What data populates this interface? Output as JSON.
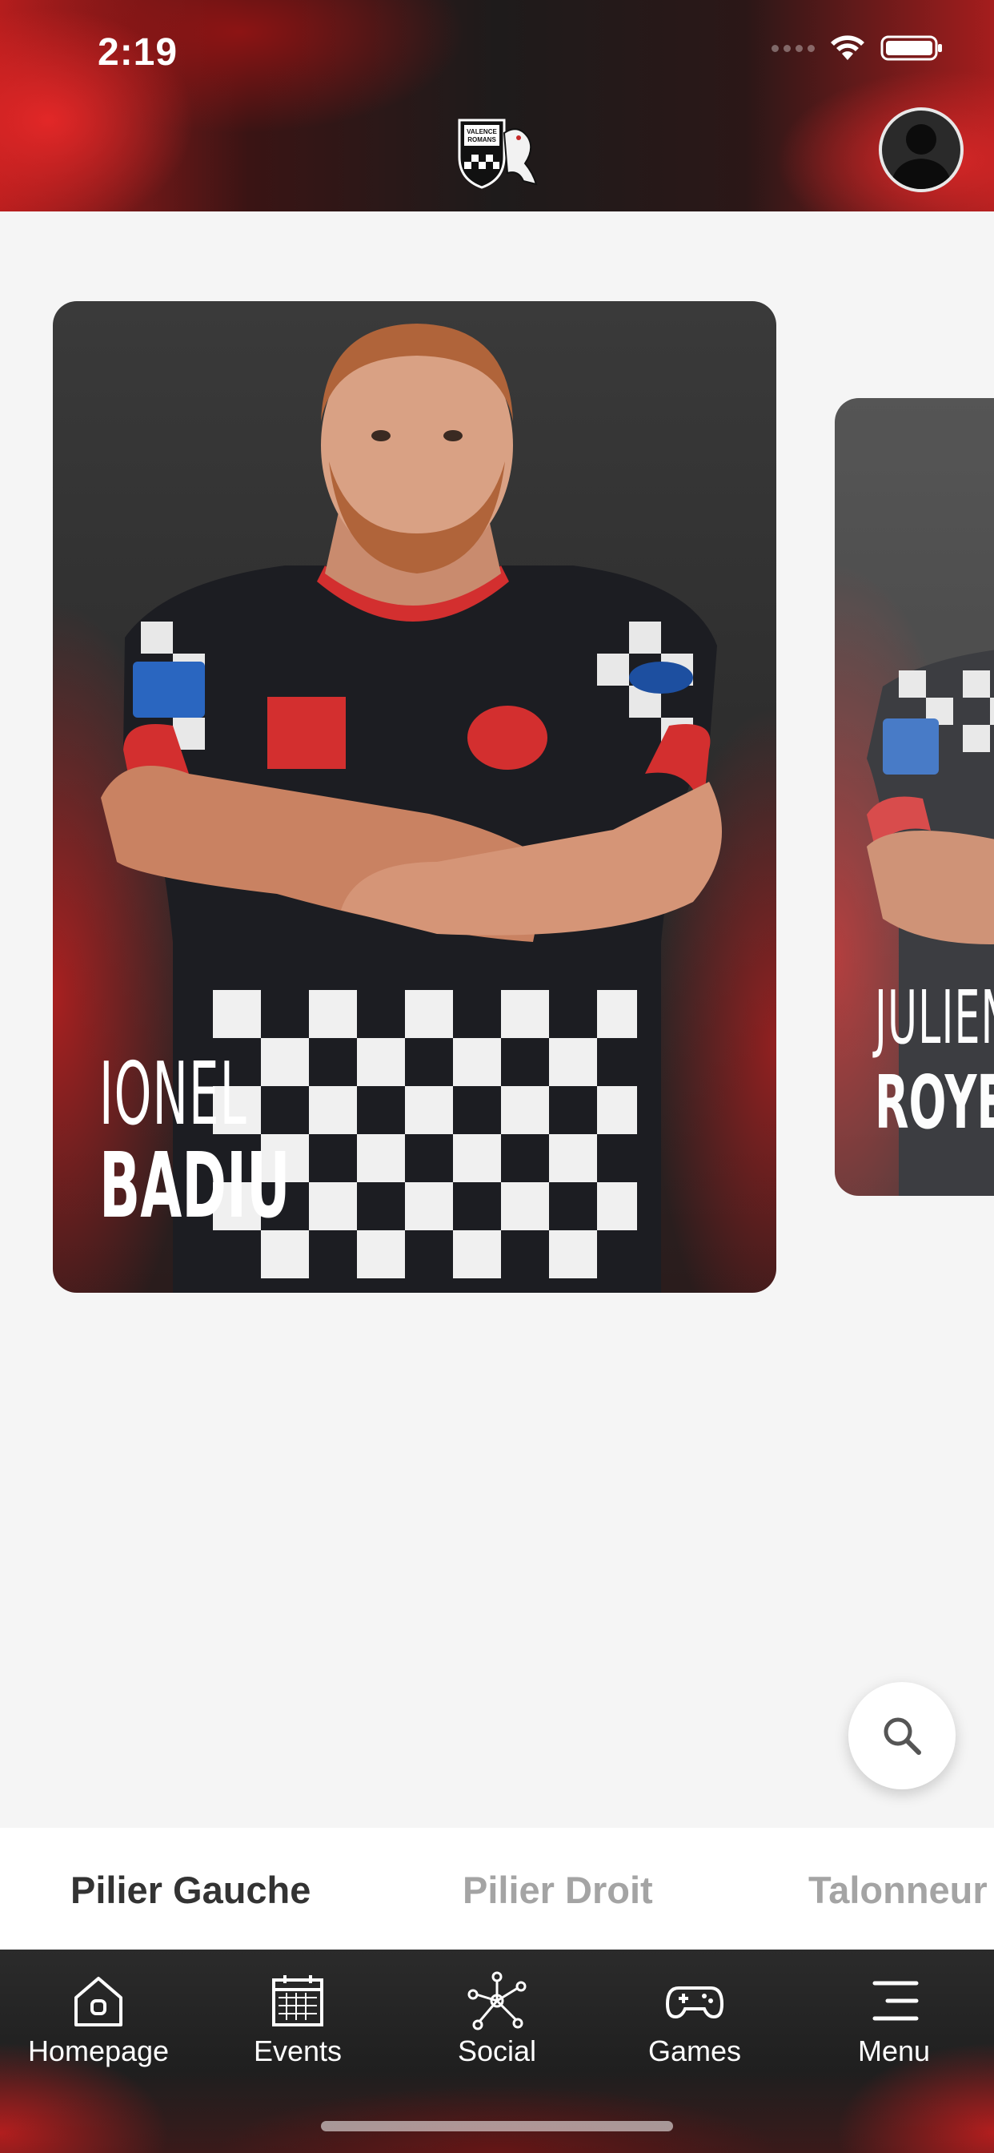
{
  "status_bar": {
    "time": "2:19"
  },
  "header": {
    "logo_icon": "valence-romans-logo",
    "avatar_icon": "user-avatar-icon"
  },
  "players": [
    {
      "first_name": "IONEL",
      "last_name": "BADIU"
    },
    {
      "first_name": "JULIEN",
      "last_name": "ROYE"
    }
  ],
  "search": {
    "icon": "search-icon"
  },
  "position_tabs": [
    {
      "label": "Pilier Gauche",
      "active": true
    },
    {
      "label": "Pilier Droit",
      "active": false
    },
    {
      "label": "Talonneur",
      "active": false
    }
  ],
  "nav": [
    {
      "label": "Homepage",
      "icon": "home-icon"
    },
    {
      "label": "Events",
      "icon": "calendar-icon"
    },
    {
      "label": "Social",
      "icon": "network-icon"
    },
    {
      "label": "Games",
      "icon": "gamepad-icon"
    },
    {
      "label": "Menu",
      "icon": "menu-icon"
    }
  ],
  "colors": {
    "brand_red": "#c62828",
    "dark": "#1f1f1f",
    "active_tab": "#333333",
    "inactive_tab": "#a4a4a4"
  }
}
